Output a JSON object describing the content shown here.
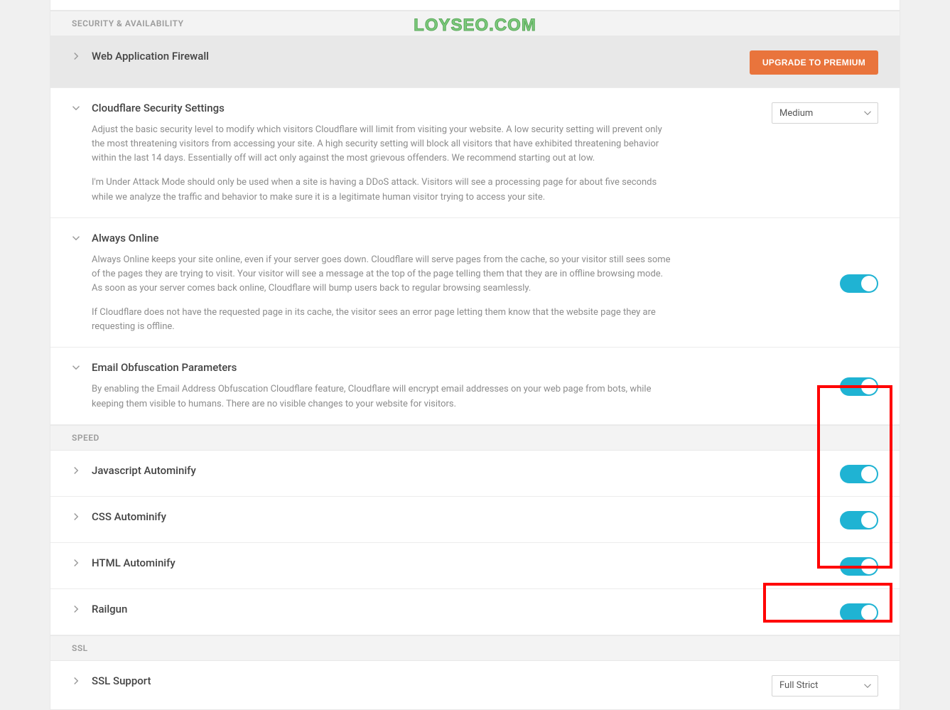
{
  "watermark": "LOYSEO.COM",
  "sections": {
    "security": {
      "header": "SECURITY & AVAILABILITY",
      "waf": {
        "title": "Web Application Firewall",
        "upgrade_button": "UPGRADE TO PREMIUM"
      },
      "cloudflare_security": {
        "title": "Cloudflare Security Settings",
        "desc1": "Adjust the basic security level to modify which visitors Cloudflare will limit from visiting your website. A low security setting will prevent only the most threatening visitors from accessing your site. A high security setting will block all visitors that have exhibited threatening behavior within the last 14 days. Essentially off will act only against the most grievous offenders. We recommend starting out at low.",
        "desc2": "I'm Under Attack Mode should only be used when a site is having a DDoS attack. Visitors will see a processing page for about five seconds while we analyze the traffic and behavior to make sure it is a legitimate human visitor trying to access your site.",
        "select_value": "Medium"
      },
      "always_online": {
        "title": "Always Online",
        "desc1": "Always Online keeps your site online, even if your server goes down. Cloudflare will serve pages from the cache, so your visitor still sees some of the pages they are trying to visit. Your visitor will see a message at the top of the page telling them that they are in offline browsing mode. As soon as your server comes back online, Cloudflare will bump users back to regular browsing seamlessly.",
        "desc2": "If Cloudflare does not have the requested page in its cache, the visitor sees an error page letting them know that the website page they are requesting is offline."
      },
      "email_obfuscation": {
        "title": "Email Obfuscation Parameters",
        "desc1": "By enabling the Email Address Obfuscation Cloudflare feature, Cloudflare will encrypt email addresses on your web page from bots, while keeping them visible to humans. There are no visible changes to your website for visitors."
      }
    },
    "speed": {
      "header": "SPEED",
      "js_autominify": {
        "title": "Javascript Autominify"
      },
      "css_autominify": {
        "title": "CSS Autominify"
      },
      "html_autominify": {
        "title": "HTML Autominify"
      },
      "railgun": {
        "title": "Railgun"
      }
    },
    "ssl": {
      "header": "SSL",
      "ssl_support": {
        "title": "SSL Support",
        "select_value": "Full Strict"
      }
    }
  }
}
